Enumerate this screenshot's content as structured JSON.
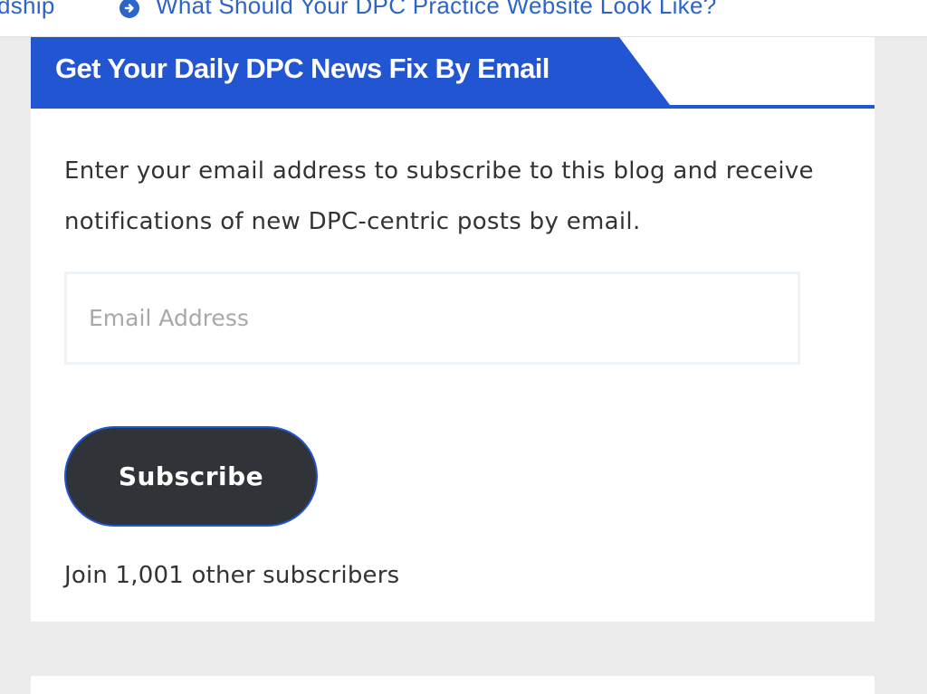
{
  "topbar": {
    "left_link": "dship",
    "right_link": "What Should Your DPC Practice Website Look Like?",
    "right_icon": "arrow-circle-right-icon"
  },
  "widget": {
    "title": "Get Your Daily DPC News Fix By Email",
    "description": "Enter your email address to subscribe to this blog and receive notifications of new DPC-centric posts by email.",
    "email_placeholder": "Email Address",
    "email_value": "",
    "subscribe_label": "Subscribe",
    "subscribers_text": "Join 1,001 other subscribers"
  },
  "colors": {
    "accent": "#2255d1",
    "link": "#2d64c9",
    "button_bg": "#303337",
    "page_bg": "#ebebeb"
  }
}
